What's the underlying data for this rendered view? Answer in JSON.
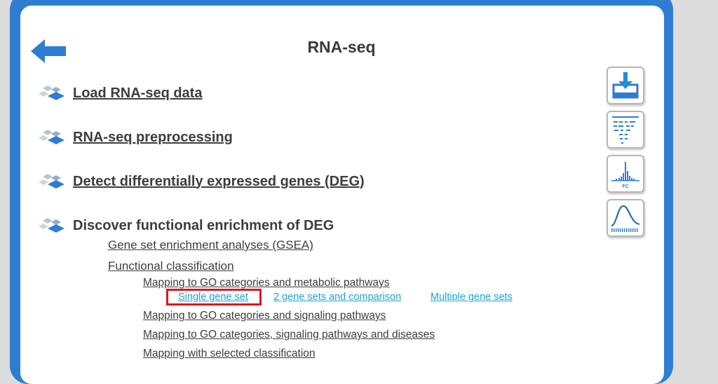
{
  "page": {
    "title": "RNA-seq"
  },
  "sections": [
    {
      "label": "Load RNA-seq data",
      "icon": "diamond-cluster-icon"
    },
    {
      "label": "RNA-seq preprocessing",
      "icon": "diamond-cluster-icon"
    },
    {
      "label": "Detect differentially expressed genes (DEG)",
      "icon": "diamond-cluster-icon"
    },
    {
      "label": "Discover functional enrichment of DEG",
      "icon": "diamond-cluster-icon"
    }
  ],
  "enrichment": {
    "gsea_label": "Gene set enrichment analyses (GSEA)",
    "functional_classification_label": "Functional classification",
    "mapping_go_metabolic_label": "Mapping to GO categories and metabolic pathways",
    "options": {
      "single": "Single gene set",
      "two": "2 gene sets and comparison",
      "multiple": "Multiple gene sets"
    },
    "mapping_go_signaling_label": "Mapping to GO categories and signaling pathways",
    "mapping_go_signaling_diseases_label": "Mapping to GO categories, signaling pathways and diseases",
    "mapping_selected_label": "Mapping with selected classification"
  },
  "side_tools": [
    {
      "icon": "download-tray-icon"
    },
    {
      "icon": "alignment-reads-icon"
    },
    {
      "icon": "fold-change-histogram-icon"
    },
    {
      "icon": "density-curve-icon"
    }
  ],
  "colors": {
    "frame": "#2f7dd1",
    "link_blue": "#1fa2d6",
    "highlight_red": "#d9181f",
    "text": "#3d3d3d"
  }
}
